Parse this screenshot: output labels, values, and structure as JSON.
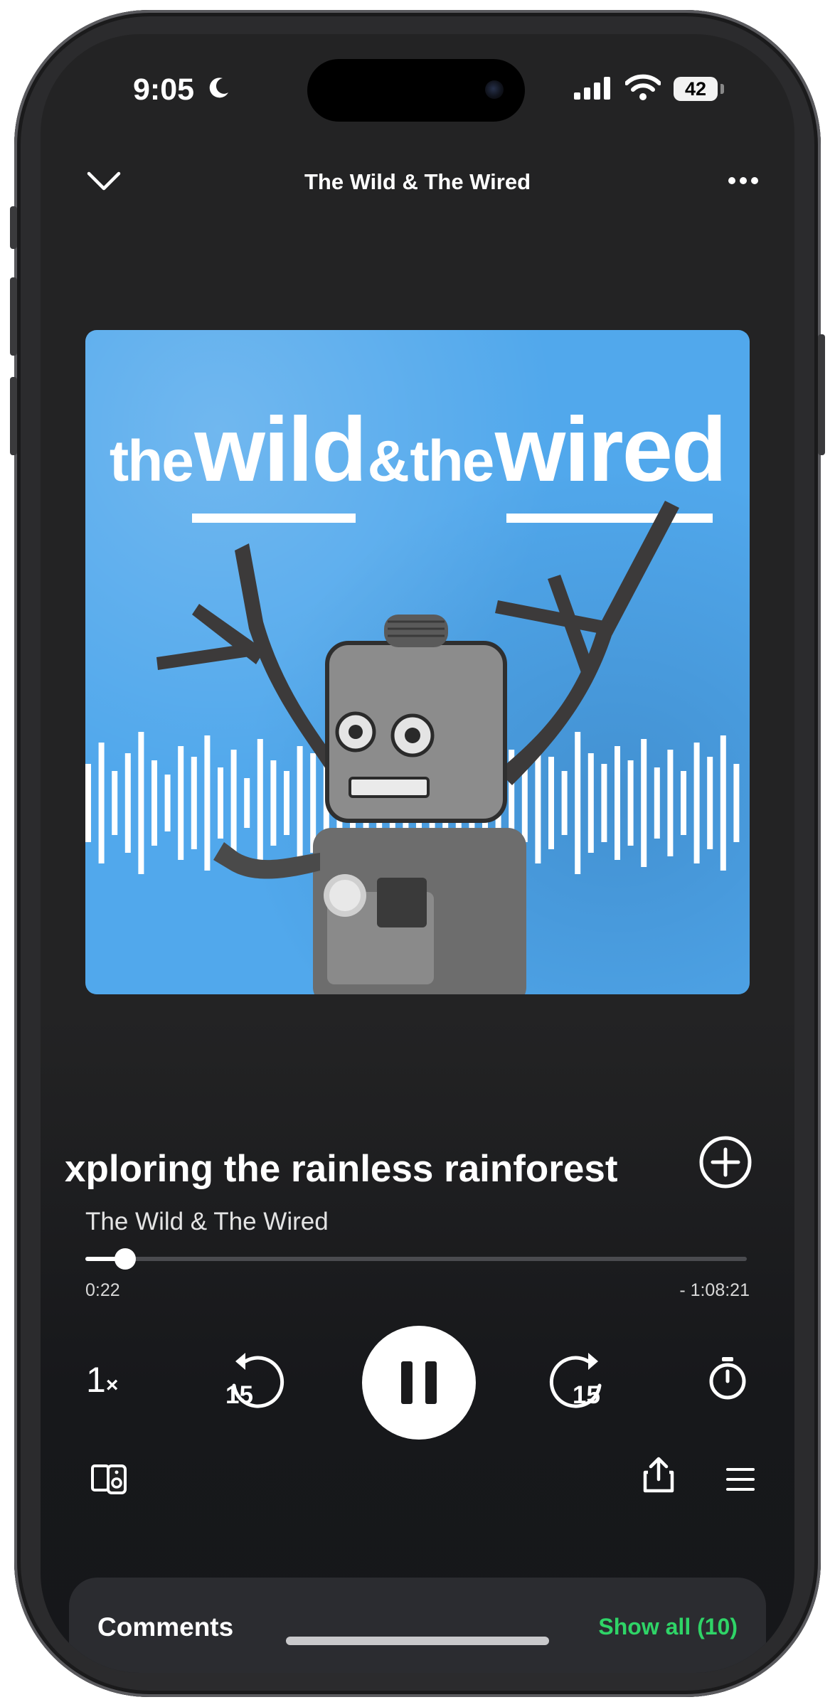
{
  "status_bar": {
    "time": "9:05",
    "battery": "42"
  },
  "header": {
    "title": "The Wild & The Wired"
  },
  "artwork": {
    "title_words": [
      "the",
      "wild",
      "&",
      "the",
      "wired"
    ]
  },
  "episode": {
    "title": "xploring the rainless rainforest",
    "show": "The Wild & The Wired"
  },
  "progress": {
    "elapsed": "0:22",
    "remaining": "- 1:08:21",
    "fraction": 0.0049
  },
  "controls": {
    "speed": "1",
    "speed_suffix": "×",
    "skip_back_seconds": "15",
    "skip_forward_seconds": "15"
  },
  "comments": {
    "label": "Comments",
    "show_all": "Show all (10)"
  },
  "colors": {
    "accent_green": "#2fd467",
    "artwork_blue": "#51a8ec",
    "background": "#232324"
  }
}
